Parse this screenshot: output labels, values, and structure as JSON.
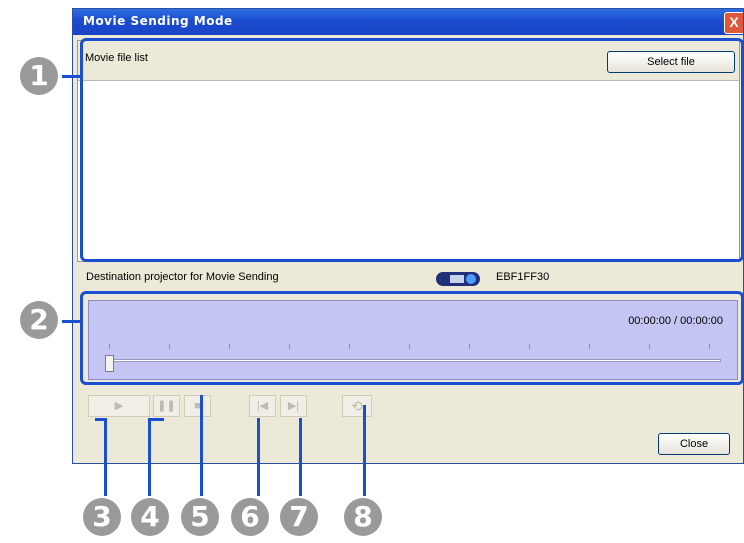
{
  "window": {
    "title": "Movie Sending Mode",
    "close_glyph": "X"
  },
  "movie_list": {
    "label": "Movie file list",
    "select_button": "Select file"
  },
  "destination": {
    "label": "Destination projector for Movie Sending",
    "projector_id": "EBF1FF30",
    "icon": "projector-icon"
  },
  "player": {
    "time": "00:00:00 / 00:00:00",
    "position_fraction": 0
  },
  "controls": {
    "play_icon": "▶",
    "pause_icon": "❚❚",
    "stop_icon": "■",
    "prev_icon": "|◀",
    "next_icon": "▶|",
    "repeat_icon": "⟲"
  },
  "close_button": "Close",
  "callouts": [
    "1",
    "2",
    "3",
    "4",
    "5",
    "6",
    "7",
    "8"
  ],
  "colors": {
    "callout": "#1c4fd0",
    "badge": "#9a9a9a",
    "player_bg": "#c5c5f3",
    "titlebar": "#1b4bcf"
  }
}
